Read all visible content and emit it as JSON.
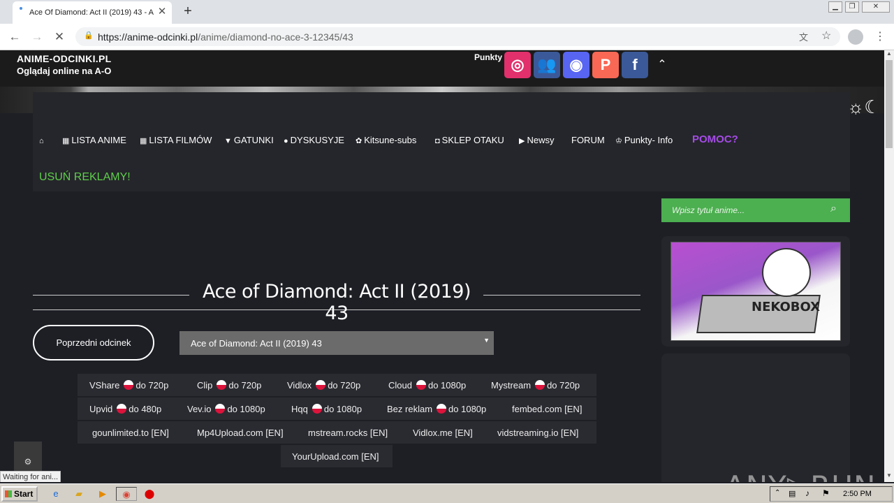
{
  "browser": {
    "tab_title": "Ace Of Diamond: Act II (2019) 43 - A",
    "new_tab": "+",
    "url_host": "https://anime-odcinki.pl",
    "url_path": "/anime/diamond-no-ace-3-12345/43"
  },
  "header": {
    "site_name": "ANIME-ODCINKI.PL",
    "site_sub": "Oglądaj online na A-O",
    "punkty": "Punkty"
  },
  "social": [
    {
      "icon": "instagram-icon",
      "glyph": "◎",
      "color": "#e1306c"
    },
    {
      "icon": "group-icon",
      "glyph": "👥",
      "color": "#3b5998"
    },
    {
      "icon": "discord-icon",
      "glyph": "◉",
      "color": "#5865f2"
    },
    {
      "icon": "patreon-icon",
      "glyph": "P",
      "color": "#f96854"
    },
    {
      "icon": "facebook-icon",
      "glyph": "f",
      "color": "#3b5998"
    }
  ],
  "nav": [
    {
      "icon": "⌂",
      "label": ""
    },
    {
      "icon": "▦",
      "label": "LISTA ANIME"
    },
    {
      "icon": "▦",
      "label": "LISTA FILMÓW"
    },
    {
      "icon": "▼",
      "label": "GATUNKI"
    },
    {
      "icon": "●",
      "label": "DYSKUSYJE"
    },
    {
      "icon": "✿",
      "label": "Kitsune-subs"
    },
    {
      "icon": "◘",
      "label": "SKLEP OTAKU"
    },
    {
      "icon": "▶",
      "label": "Newsy"
    },
    {
      "icon": "",
      "label": "FORUM"
    },
    {
      "icon": "♔",
      "label": "Punkty- Info"
    }
  ],
  "nav_pomoc": "POMOC?",
  "nav_usun": "USUŃ REKLAMY!",
  "search": {
    "placeholder": "Wpisz tytuł anime..."
  },
  "ad": {
    "label": "NEKOBOX"
  },
  "episode": {
    "title": "Ace of Diamond: Act II (2019) 43",
    "prev_label": "Poprzedni odcinek",
    "selected": "Ace of Diamond: Act II (2019) 43"
  },
  "players": [
    [
      {
        "name": "VShare",
        "flag": true,
        "q": "do 720p"
      },
      {
        "name": "Clip",
        "flag": true,
        "q": "do 720p"
      },
      {
        "name": "Vidlox",
        "flag": true,
        "q": "do 720p"
      },
      {
        "name": "Cloud",
        "flag": true,
        "q": "do 1080p"
      },
      {
        "name": "Mystream",
        "flag": true,
        "q": "do 720p"
      }
    ],
    [
      {
        "name": "Upvid",
        "flag": true,
        "q": "do 480p"
      },
      {
        "name": "Vev.io",
        "flag": true,
        "q": "do 1080p"
      },
      {
        "name": "Hqq",
        "flag": true,
        "q": "do 1080p"
      },
      {
        "name": "Bez reklam",
        "flag": true,
        "q": "do 1080p"
      },
      {
        "name": "fembed.com [EN]",
        "flag": false,
        "q": ""
      }
    ],
    [
      {
        "name": "gounlimited.to [EN]",
        "flag": false,
        "q": ""
      },
      {
        "name": "Mp4Upload.com [EN]",
        "flag": false,
        "q": ""
      },
      {
        "name": "mstream.rocks [EN]",
        "flag": false,
        "q": ""
      },
      {
        "name": "Vidlox.me [EN]",
        "flag": false,
        "q": ""
      },
      {
        "name": "vidstreaming.io [EN]",
        "flag": false,
        "q": ""
      }
    ],
    [
      {
        "name": "YourUpload.com [EN]",
        "flag": false,
        "q": ""
      }
    ]
  ],
  "status": "Waiting for ani...",
  "watermark": "ANY▷RUN",
  "taskbar": {
    "start": "Start",
    "clock": "2:50 PM"
  }
}
